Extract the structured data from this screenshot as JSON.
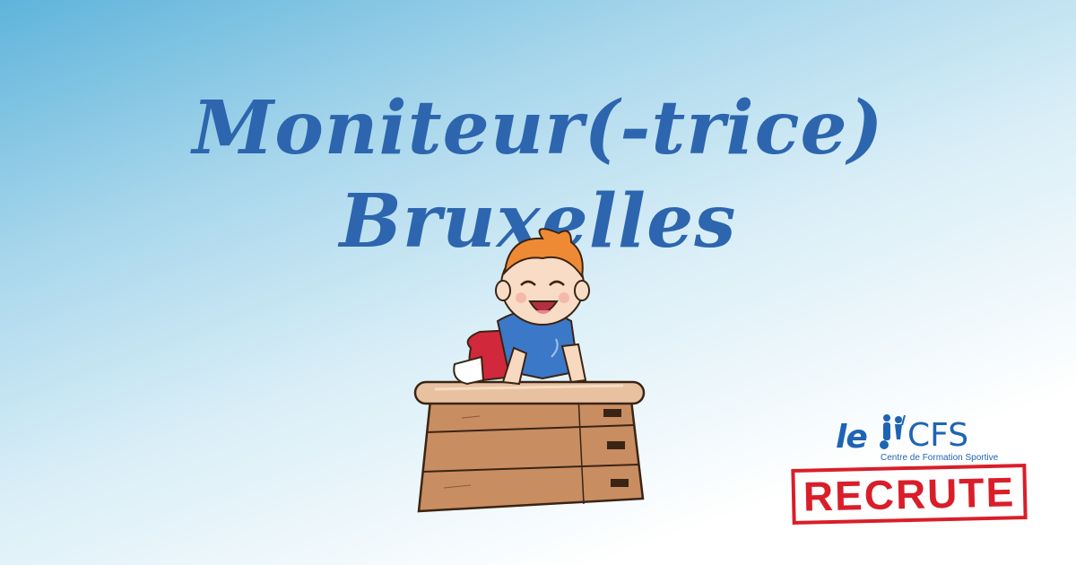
{
  "title": {
    "line1": "Moniteur(-trice)",
    "line2": "Bruxelles"
  },
  "logo": {
    "prefix": "le",
    "name": "CFS",
    "subtitle": "Centre de Formation Sportive"
  },
  "stamp": "RECRUTE",
  "illustration": "child-on-vaulting-box",
  "colors": {
    "title": "#2d66ae",
    "logo": "#1e64b4",
    "stamp": "#d91e2a",
    "background_top": "#5fb4db",
    "background_bottom": "#ffffff"
  }
}
